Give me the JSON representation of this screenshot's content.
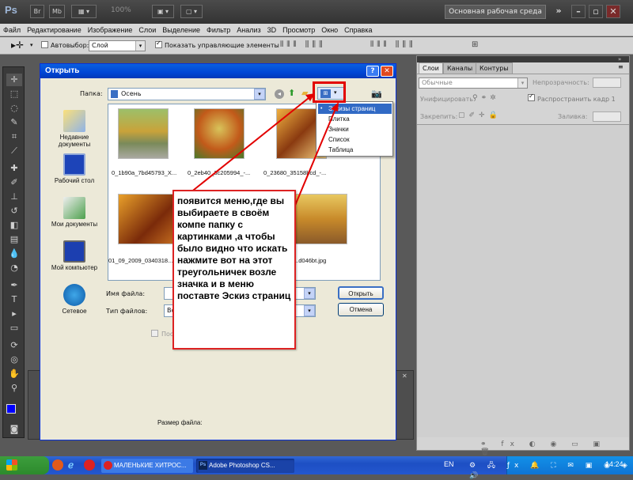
{
  "app": {
    "logo": "Ps",
    "zoom": "100%",
    "workspace": "Основная рабочая среда"
  },
  "menu": [
    "Файл",
    "Редактирование",
    "Изображение",
    "Слои",
    "Выделение",
    "Фильтр",
    "Анализ",
    "3D",
    "Просмотр",
    "Окно",
    "Справка"
  ],
  "options_bar": {
    "autoselect_label": "Автовыбор:",
    "autoselect_value": "Слой",
    "show_controls_label": "Показать управляющие элементы"
  },
  "panel": {
    "tabs": [
      "Слои",
      "Каналы",
      "Контуры"
    ],
    "blend_mode": "Обычные",
    "opacity_label": "Непрозрачность:",
    "lock_label": "Унифицировать:",
    "propagate_label": "Распространить кадр 1",
    "fix_label": "Закрепить:",
    "fill_label": "Заливка:"
  },
  "dialog": {
    "title": "Открыть",
    "folder_label": "Папка:",
    "folder_value": "Осень",
    "places": [
      "Недавние документы",
      "Рабочий стол",
      "Мои документы",
      "Мой компьютер",
      "Сетевое"
    ],
    "files": [
      "0_1b90a_7bd45793_X...",
      "0_2eb40_3c205994_-...",
      "0_23680_35158bcd_-...",
      "01_09_2009_0340318...",
      "...d046bt.jpg"
    ],
    "filename_label": "Имя файла:",
    "filetype_label": "Тип файлов:",
    "filetype_value": "Вс",
    "partial_checkbox_label": "Пос",
    "open_button": "Открыть",
    "cancel_button": "Отмена",
    "filesize_label": "Размер файла:"
  },
  "view_menu": [
    "Эскизы страниц",
    "Плитка",
    "Значки",
    "Список",
    "Таблица"
  ],
  "annotation": "появится меню,где вы выбираете в своём компе папку с картинками ,а чтобы было видно что искать нажмите вот на этот треугольничек возле значка и в меню поставте Эскиз страниц",
  "taskbar": {
    "task1": "МАЛЕНЬКИЕ ХИТРОС...",
    "task2": "Adobe Photoshop CS...",
    "lang": "EN",
    "time": "14:24"
  },
  "colors": {
    "xp_blue": "#0046d5",
    "highlight_red": "#e20000",
    "ps_dark": "#3a3a3a"
  }
}
